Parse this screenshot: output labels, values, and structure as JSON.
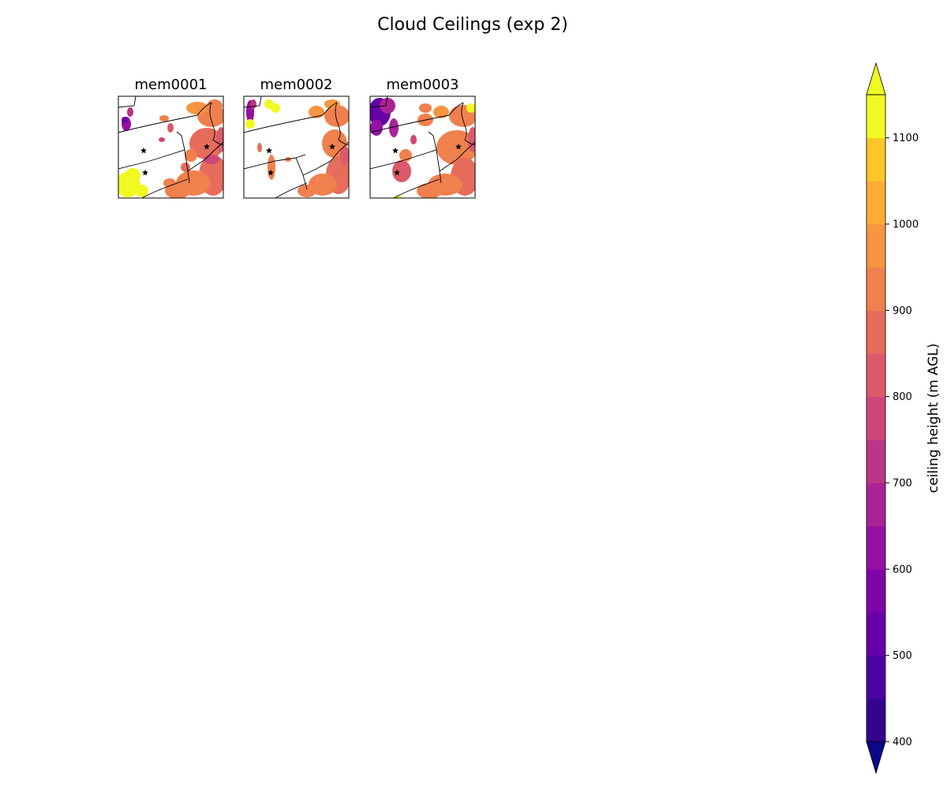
{
  "chart_data": {
    "type": "heatmap",
    "title": "Cloud Ceilings (exp 2)",
    "panels": [
      {
        "title": "mem0001"
      },
      {
        "title": "mem0002"
      },
      {
        "title": "mem0003"
      }
    ],
    "colorbar": {
      "label": "ceiling height (m AGL)",
      "ticks": [
        "400",
        "500",
        "600",
        "700",
        "800",
        "900",
        "1000",
        "1100"
      ],
      "range": [
        400,
        1150
      ],
      "level_step": 50,
      "extend": "both",
      "colormap": "plasma",
      "colors": [
        "#0d0887",
        "#33058f",
        "#4c02a1",
        "#6600a7",
        "#7e03a8",
        "#9511a1",
        "#aa2395",
        "#bc3587",
        "#cc4778",
        "#da5a6a",
        "#e66c5c",
        "#f0804e",
        "#f89540",
        "#fdac33",
        "#fdc527",
        "#f0f921"
      ]
    },
    "markers": "black stars",
    "grid": false
  }
}
